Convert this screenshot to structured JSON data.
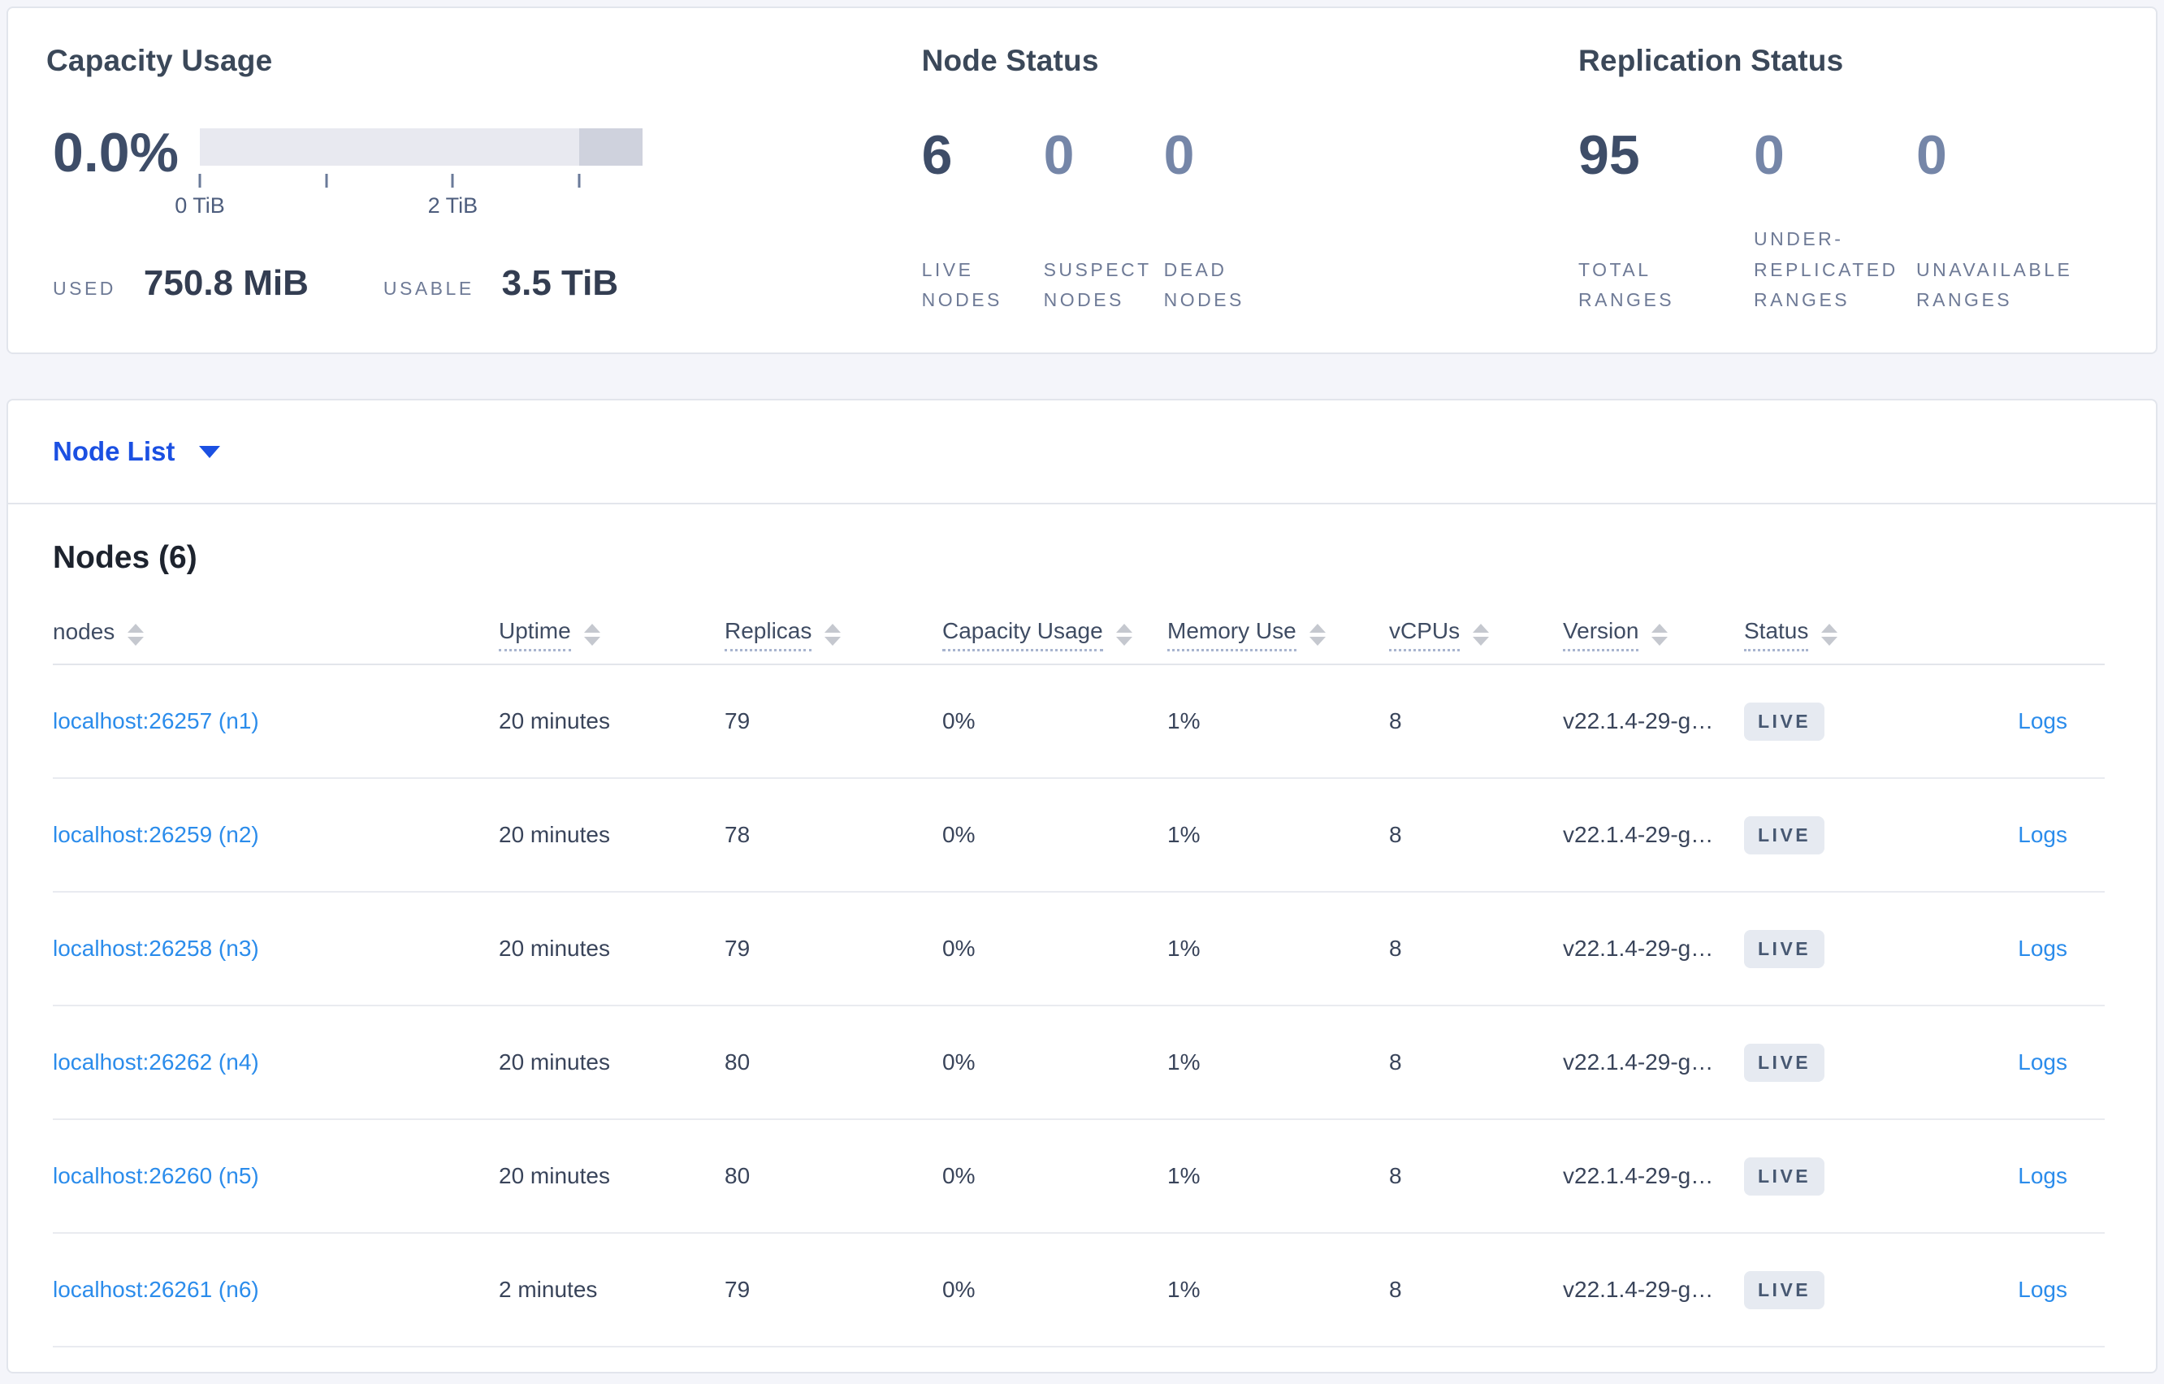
{
  "metrics": {
    "capacity": {
      "title": "Capacity Usage",
      "percent": "0.0%",
      "used_label": "USED",
      "used_value": "750.8 MiB",
      "usable_label": "USABLE",
      "usable_value": "3.5 TiB",
      "bar": {
        "scale_ticks_tib": [
          0,
          1,
          2,
          3
        ],
        "tick_label_0": "0 TiB",
        "tick_label_2": "2 TiB",
        "total_tib": 3.5,
        "light_color": "#e8e9f0",
        "dark_color": "#cfd2dd"
      }
    },
    "node_status": {
      "title": "Node Status",
      "stats": [
        {
          "value": "6",
          "label": "LIVE\nNODES"
        },
        {
          "value": "0",
          "label": "SUSPECT\nNODES"
        },
        {
          "value": "0",
          "label": "DEAD\nNODES"
        }
      ]
    },
    "replication": {
      "title": "Replication Status",
      "stats": [
        {
          "value": "95",
          "label": "TOTAL\nRANGES"
        },
        {
          "value": "0",
          "label": "UNDER-\nREPLICATED\nRANGES"
        },
        {
          "value": "0",
          "label": "UNAVAILABLE\nRANGES"
        }
      ]
    }
  },
  "view_selector": {
    "label": "Node List"
  },
  "table": {
    "title": "Nodes (6)",
    "columns": [
      {
        "label": "nodes"
      },
      {
        "label": "Uptime"
      },
      {
        "label": "Replicas"
      },
      {
        "label": "Capacity Usage"
      },
      {
        "label": "Memory Use"
      },
      {
        "label": "vCPUs"
      },
      {
        "label": "Version"
      },
      {
        "label": "Status"
      },
      {
        "label": ""
      }
    ],
    "rows": [
      {
        "node": "localhost:26257 (n1)",
        "uptime": "20 minutes",
        "replicas": "79",
        "capacity": "0%",
        "memory": "1%",
        "vcpus": "8",
        "version": "v22.1.4-29-g…",
        "status": "LIVE",
        "logs": "Logs"
      },
      {
        "node": "localhost:26259 (n2)",
        "uptime": "20 minutes",
        "replicas": "78",
        "capacity": "0%",
        "memory": "1%",
        "vcpus": "8",
        "version": "v22.1.4-29-g…",
        "status": "LIVE",
        "logs": "Logs"
      },
      {
        "node": "localhost:26258 (n3)",
        "uptime": "20 minutes",
        "replicas": "79",
        "capacity": "0%",
        "memory": "1%",
        "vcpus": "8",
        "version": "v22.1.4-29-g…",
        "status": "LIVE",
        "logs": "Logs"
      },
      {
        "node": "localhost:26262 (n4)",
        "uptime": "20 minutes",
        "replicas": "80",
        "capacity": "0%",
        "memory": "1%",
        "vcpus": "8",
        "version": "v22.1.4-29-g…",
        "status": "LIVE",
        "logs": "Logs"
      },
      {
        "node": "localhost:26260 (n5)",
        "uptime": "20 minutes",
        "replicas": "80",
        "capacity": "0%",
        "memory": "1%",
        "vcpus": "8",
        "version": "v22.1.4-29-g…",
        "status": "LIVE",
        "logs": "Logs"
      },
      {
        "node": "localhost:26261 (n6)",
        "uptime": "2 minutes",
        "replicas": "79",
        "capacity": "0%",
        "memory": "1%",
        "vcpus": "8",
        "version": "v22.1.4-29-g…",
        "status": "LIVE",
        "logs": "Logs"
      }
    ],
    "colors": {
      "link": "#2b8ceb",
      "selector_blue": "#1b50e2",
      "badge_bg": "#e6eaf1",
      "badge_text": "#475872"
    }
  }
}
